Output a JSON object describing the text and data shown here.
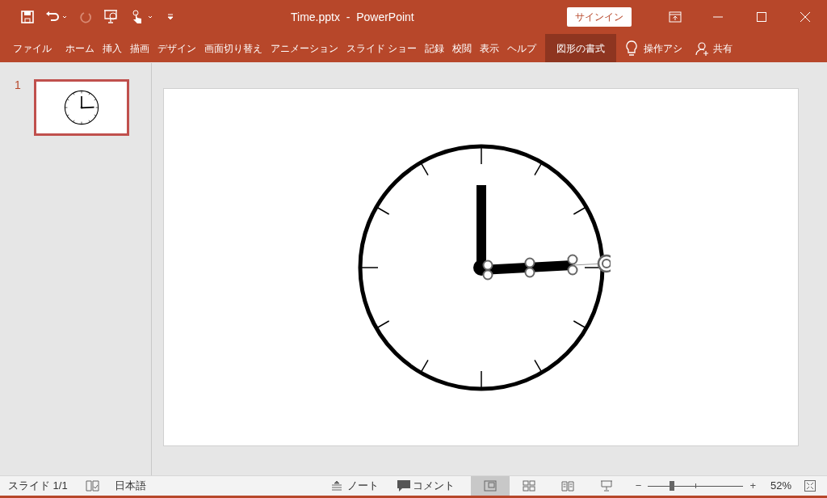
{
  "window": {
    "title": "Time.pptx  -  PowerPoint",
    "signin": "サインイン"
  },
  "ribbon_tabs": [
    {
      "label": "ファイル",
      "selected": false
    },
    {
      "label": "ホーム",
      "selected": false
    },
    {
      "label": "挿入",
      "selected": false
    },
    {
      "label": "描画",
      "selected": false
    },
    {
      "label": "デザイン",
      "selected": false
    },
    {
      "label": "画面切り替え",
      "selected": false
    },
    {
      "label": "アニメーション",
      "selected": false
    },
    {
      "label": "スライド ショー",
      "selected": false
    },
    {
      "label": "記録",
      "selected": false
    },
    {
      "label": "校閲",
      "selected": false
    },
    {
      "label": "表示",
      "selected": false
    },
    {
      "label": "ヘルプ",
      "selected": false
    },
    {
      "label": "図形の書式",
      "selected": true
    }
  ],
  "tell_me": "操作アシ",
  "share": "共有",
  "thumbnails": [
    {
      "number": "1",
      "selected": true
    }
  ],
  "status_bar": {
    "slide": "スライド 1/1",
    "language": "日本語",
    "notes": "ノート",
    "comments": "コメント",
    "views": [
      {
        "kind": "normal",
        "selected": true
      },
      {
        "kind": "sorter",
        "selected": false
      },
      {
        "kind": "reading",
        "selected": false
      },
      {
        "kind": "show",
        "selected": false
      }
    ],
    "zoom": {
      "out": "−",
      "in": "+",
      "level": 0.25,
      "reading": "52%"
    }
  }
}
